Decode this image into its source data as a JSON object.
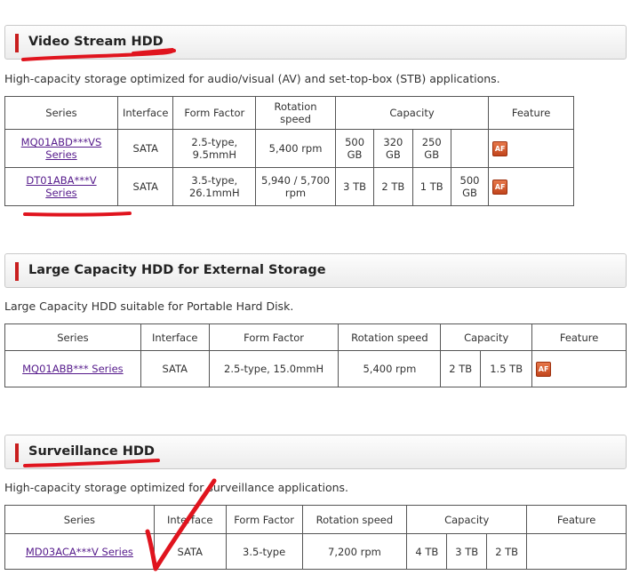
{
  "sections": [
    {
      "title": "Video Stream HDD",
      "description": "High-capacity storage optimized for audio/visual (AV) and set-top-box (STB) applications.",
      "headers": [
        "Series",
        "Interface",
        "Form Factor",
        "Rotation speed",
        "Capacity",
        "Feature"
      ],
      "rows": [
        {
          "series": "MQ01ABD***VS Series",
          "interface": "SATA",
          "form_factor": "2.5-type, 9.5mmH",
          "rotation": "5,400 rpm",
          "capacity": [
            "500 GB",
            "320 GB",
            "250 GB",
            ""
          ],
          "feature": "AF"
        },
        {
          "series": "DT01ABA***V Series",
          "interface": "SATA",
          "form_factor": "3.5-type, 26.1mmH",
          "rotation": "5,940 / 5,700 rpm",
          "capacity": [
            "3 TB",
            "2 TB",
            "1 TB",
            "500 GB"
          ],
          "feature": "AF"
        }
      ]
    },
    {
      "title": "Large Capacity HDD for External Storage",
      "description": "Large Capacity HDD suitable for Portable Hard Disk.",
      "headers": [
        "Series",
        "Interface",
        "Form Factor",
        "Rotation speed",
        "Capacity",
        "Feature"
      ],
      "rows": [
        {
          "series": "MQ01ABB*** Series",
          "interface": "SATA",
          "form_factor": "2.5-type, 15.0mmH",
          "rotation": "5,400 rpm",
          "capacity": [
            "2 TB",
            "1.5 TB"
          ],
          "feature": "AF"
        }
      ]
    },
    {
      "title": "Surveillance HDD",
      "description": "High-capacity storage optimized for surveillance applications.",
      "headers": [
        "Series",
        "Interface",
        "Form Factor",
        "Rotation speed",
        "Capacity",
        "Feature"
      ],
      "rows": [
        {
          "series": "MD03ACA***V Series",
          "interface": "SATA",
          "form_factor": "3.5-type",
          "rotation": "7,200 rpm",
          "capacity": [
            "4 TB",
            "3 TB",
            "2 TB"
          ],
          "feature": ""
        }
      ]
    }
  ],
  "colors": {
    "accent_bar": "#c81e1e",
    "link": "#551a8b",
    "annotation": "#e0141e",
    "af_badge": "#d65a2b"
  },
  "icons": {
    "feature_badge": "af-badge-icon"
  }
}
